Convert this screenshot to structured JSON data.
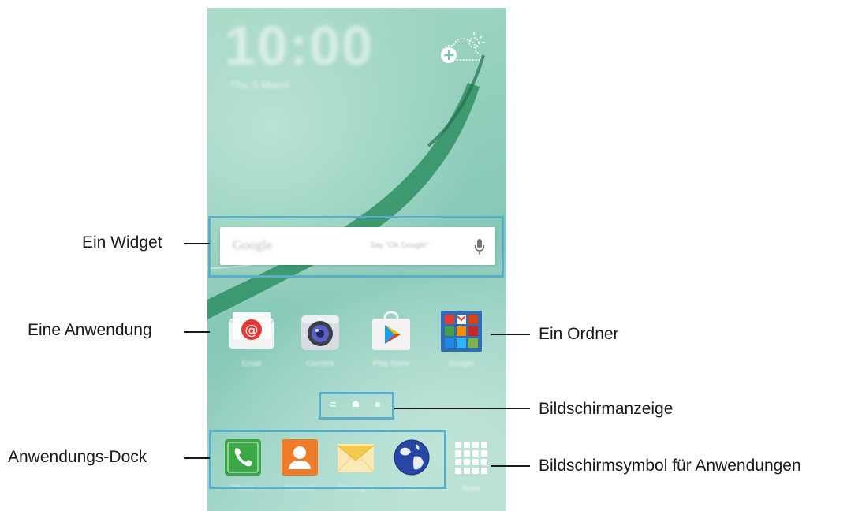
{
  "home_screen": {
    "clock": "10:00",
    "date": "Thu, 5 March",
    "search_widget": {
      "logo": "Google",
      "hint": "Say \"Ok Google\""
    },
    "apps": [
      {
        "label": "Email",
        "icon": "email-icon"
      },
      {
        "label": "Camera",
        "icon": "camera-icon"
      },
      {
        "label": "Play Store",
        "icon": "play-store-icon"
      },
      {
        "label": "Google",
        "icon": "google-folder-icon"
      }
    ],
    "dock": [
      {
        "label": "Phone",
        "icon": "phone-icon"
      },
      {
        "label": "Contacts",
        "icon": "contacts-icon"
      },
      {
        "label": "Messages",
        "icon": "messages-icon"
      },
      {
        "label": "Internet",
        "icon": "internet-icon"
      },
      {
        "label": "Apps",
        "icon": "apps-grid-icon"
      }
    ]
  },
  "callouts": {
    "widget": "Ein Widget",
    "application": "Eine Anwendung",
    "folder": "Ein Ordner",
    "screen_indicator": "Bildschirmanzeige",
    "app_dock": "Anwendungs-Dock",
    "apps_screen_icon": "Bildschirmsymbol für Anwendungen"
  },
  "colors": {
    "callout_frame": "#5aaec6",
    "wallpaper": "#93cfbd"
  }
}
